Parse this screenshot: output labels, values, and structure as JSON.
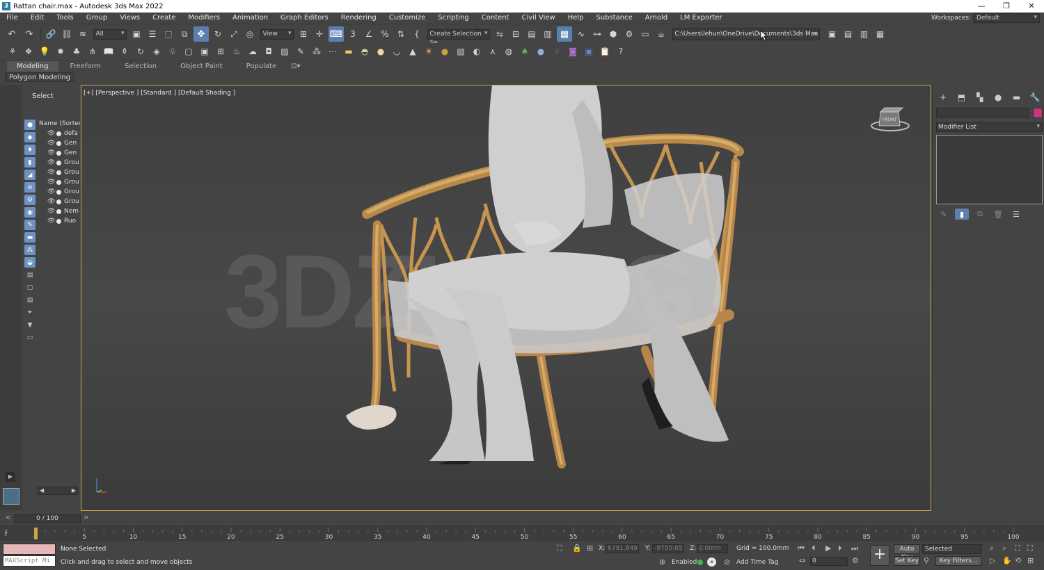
{
  "window": {
    "title": "Rattan chair.max - Autodesk 3ds Max 2022",
    "controls": [
      "—",
      "❐",
      "✕"
    ]
  },
  "menu": [
    "File",
    "Edit",
    "Tools",
    "Group",
    "Views",
    "Create",
    "Modifiers",
    "Animation",
    "Graph Editors",
    "Rendering",
    "Customize",
    "Scripting",
    "Content",
    "Civil View",
    "Help",
    "Substance",
    "Arnold",
    "LM Exporter"
  ],
  "workspace": {
    "label": "Workspaces:",
    "value": "Default"
  },
  "toolbar": {
    "selection_filter": "All",
    "ref_coord": "View",
    "named_selection": "Create Selection Se",
    "project_path": "C:\\Users\\lehun\\OneDrive\\Documents\\3ds Max 2022"
  },
  "ribbon": {
    "tabs": [
      "Modeling",
      "Freeform",
      "Selection",
      "Object Paint",
      "Populate"
    ],
    "active": "Modeling",
    "subtab": "Polygon Modeling"
  },
  "scene_explorer": {
    "select_label": "Select",
    "column_header": "Name (Sorted A",
    "rows": [
      "defa",
      "Gen",
      "Gen",
      "Grou",
      "Grou",
      "Grou",
      "Grou",
      "Grou",
      "Nem",
      "Ruo"
    ]
  },
  "viewport": {
    "label": "[+] [Perspective ] [Standard ] [Default Shading ]",
    "watermark": "3DZI.ORG",
    "viewcube_label": "FRONT"
  },
  "command_panel": {
    "modifier_list": "Modifier List",
    "color": "#c8377c"
  },
  "timeline": {
    "frame": "0 / 100",
    "ticks": [
      "0",
      "5",
      "10",
      "15",
      "20",
      "25",
      "30",
      "35",
      "40",
      "45",
      "50",
      "55",
      "60",
      "65",
      "70",
      "75",
      "80",
      "85",
      "90",
      "95",
      "100"
    ]
  },
  "status": {
    "maxscript_placeholder": "MAXScript Mi",
    "selection": "None Selected",
    "prompt": "Click and drag to select and move objects",
    "x_label": "X:",
    "x_value": "6791.849m",
    "y_label": "Y:",
    "y_value": "-9750.651m",
    "z_label": "Z:",
    "z_value": "0.0mm",
    "grid": "Grid = 100.0mm",
    "enabled_label": "Enabled:",
    "add_time_tag": "Add Time Tag",
    "auto_key": "Auto Key",
    "set_key": "Set Key",
    "selected_dd": "Selected",
    "key_filters": "Key Filters...",
    "frame_value": "0"
  }
}
